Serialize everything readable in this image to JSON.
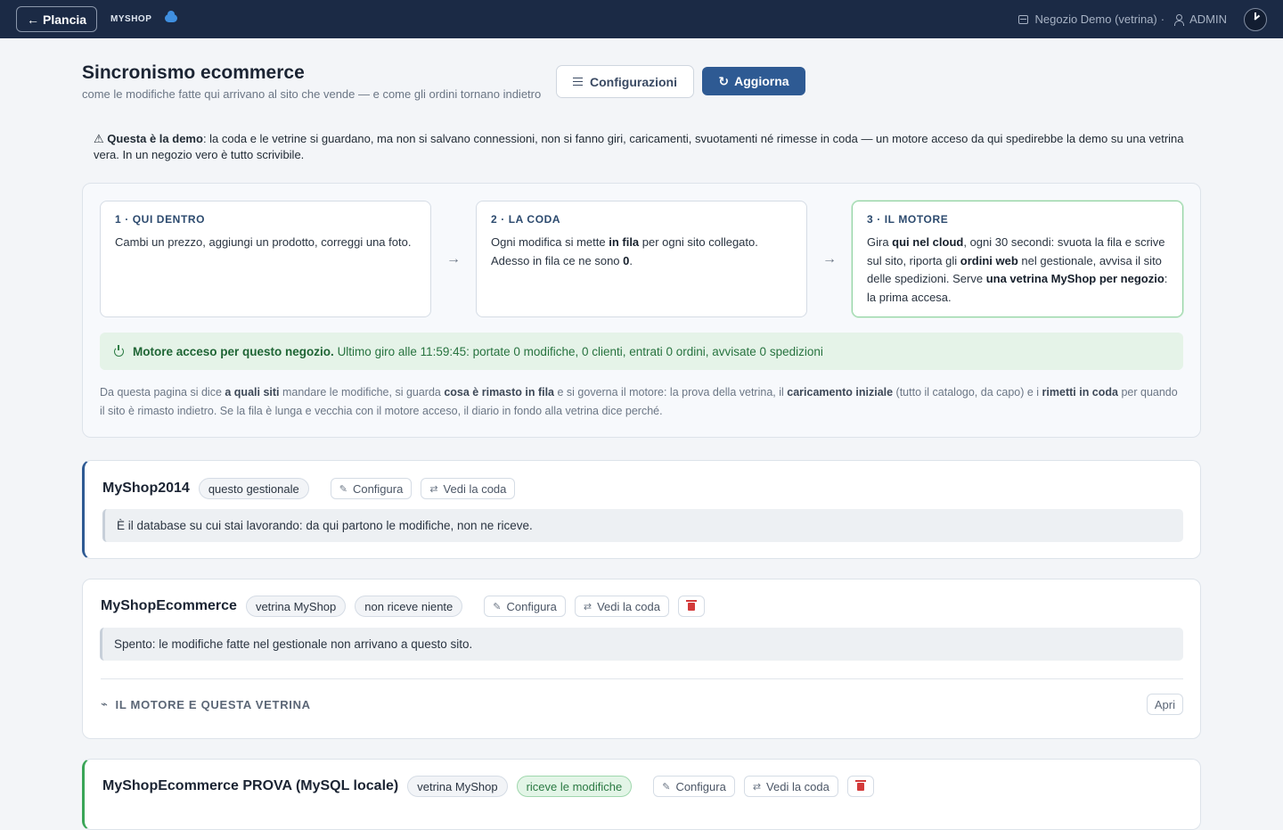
{
  "topbar": {
    "back_label": "Plancia",
    "brand": "MYSHOP",
    "shop": "Negozio Demo (vetrina)",
    "separator": "·",
    "user": "ADMIN"
  },
  "header": {
    "title": "Sincronismo ecommerce",
    "subtitle": "come le modifiche fatte qui arrivano al sito che vende — e come gli ordini tornano indietro",
    "config_button": "Configurazioni",
    "refresh_button": "Aggiorna"
  },
  "notice": {
    "icon": "⚠",
    "lead": "Questa è la demo",
    "text": ": la coda e le vetrine si guardano, ma non si salvano connessioni, non si fanno giri, caricamenti, svuotamenti né rimesse in coda — un motore acceso da qui spedirebbe la demo su una vetrina vera. In un negozio vero è tutto scrivibile."
  },
  "process": {
    "steps": [
      {
        "title": "1 · QUI DENTRO",
        "text": "Cambi un prezzo, aggiungi un prodotto, correggi una foto."
      },
      {
        "title": "2 · LA CODA",
        "t1": "Ogni modifica si mette ",
        "b1": "in fila",
        "t2": " per ogni sito collegato. Adesso in fila ce ne sono ",
        "b2": "0",
        "t3": "."
      },
      {
        "title": "3 · IL MOTORE",
        "t1": "Gira ",
        "b1": "qui nel cloud",
        "t2": ", ogni 30 secondi: svuota la fila e scrive sul sito, riporta gli ",
        "b2": "ordini web",
        "t3": " nel gestionale, avvisa il sito delle spedizioni. Serve ",
        "b3": "una vetrina MyShop per negozio",
        "t4": ": la prima accesa."
      }
    ],
    "arrow": "→",
    "engine_status_bold": "Motore acceso per questo negozio.",
    "engine_status_text": "Ultimo giro alle 11:59:45: portate 0 modifiche, 0 clienti, entrati 0 ordini, avvisate 0 spedizioni",
    "desc": {
      "t1": "Da questa pagina si dice ",
      "b1": "a quali siti",
      "t2": " mandare le modifiche, si guarda ",
      "b2": "cosa è rimasto in fila",
      "t3": " e si governa il motore: la prova della vetrina, il ",
      "b3": "caricamento iniziale",
      "t4": " (tutto il catalogo, da capo) e i ",
      "b4": "rimetti in coda",
      "t5": " per quando il sito è rimasto indietro. Se la fila è lunga e vecchia con il motore acceso, il diario in fondo alla vetrina dice perché."
    }
  },
  "stores": [
    {
      "name": "MyShop2014",
      "badges": [
        "questo gestionale"
      ],
      "configure": "Configura",
      "queue": "Vedi la coda",
      "note": "È il database su cui stai lavorando: da qui partono le modifiche, non ne riceve."
    },
    {
      "name": "MyShopEcommerce",
      "badges": [
        "vetrina MyShop",
        "non riceve niente"
      ],
      "configure": "Configura",
      "queue": "Vedi la coda",
      "note": "Spento: le modifiche fatte nel gestionale non arrivano a questo sito.",
      "engine_section": "IL MOTORE E QUESTA VETRINA",
      "open": "Apri"
    },
    {
      "name": "MyShopEcommerce PROVA (MySQL locale)",
      "badges": [
        "vetrina MyShop",
        "riceve le modifiche"
      ],
      "configure": "Configura",
      "queue": "Vedi la coda"
    }
  ]
}
